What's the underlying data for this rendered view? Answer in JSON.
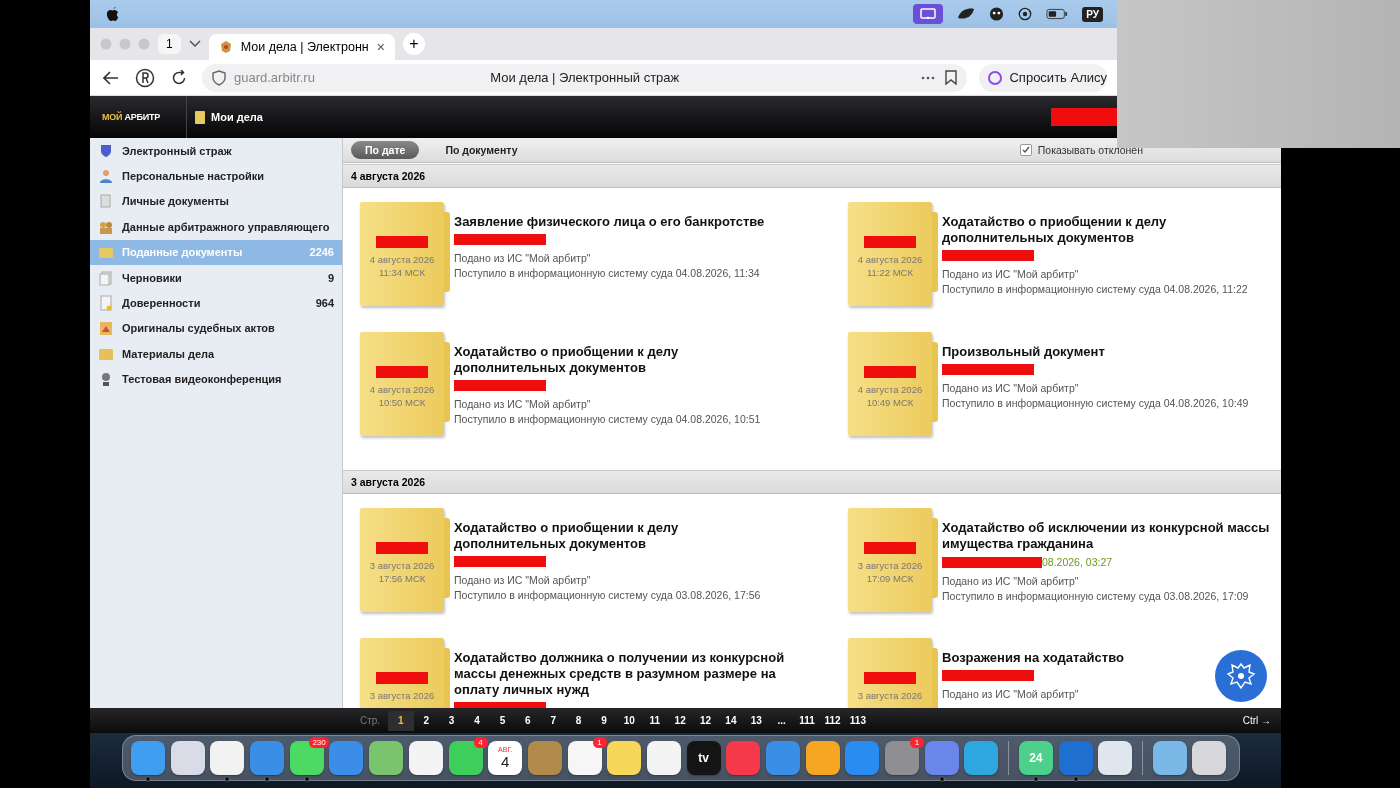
{
  "menubar": {
    "input_source": "РУ"
  },
  "browser": {
    "tab_count": "1",
    "tab": {
      "title": "Мои дела | Электронн",
      "close": "×"
    },
    "new_tab": "+",
    "address": "guard.arbitr.ru",
    "page_title": "Мои дела | Электронный страж",
    "assistant": "Спросить Алису"
  },
  "app_header": {
    "logo": [
      "МОЙ",
      "АРБИТР"
    ],
    "section": "Мои дела"
  },
  "sidebar": {
    "items": [
      {
        "label": "Электронный страж",
        "selected": false
      },
      {
        "label": "Персональные настройки",
        "selected": false
      },
      {
        "label": "Личные документы",
        "selected": false
      },
      {
        "label": "Данные арбитражного управляющего",
        "selected": false
      },
      {
        "label": "Поданные документы",
        "count": "2246",
        "selected": true
      },
      {
        "label": "Черновики",
        "count": "9",
        "selected": false
      },
      {
        "label": "Доверенности",
        "count": "964",
        "selected": false
      },
      {
        "label": "Оригиналы судебных актов",
        "selected": false
      },
      {
        "label": "Материалы дела",
        "selected": false
      },
      {
        "label": "Тестовая видеоконференция",
        "selected": false
      }
    ]
  },
  "toolbar": {
    "sort_tabs": [
      {
        "label": "По дате",
        "selected": true
      },
      {
        "label": "По документу",
        "selected": false
      }
    ],
    "show_rejected": {
      "label": "Показывать отклонен",
      "checked": true
    }
  },
  "sections": [
    {
      "date": "4 августа 2026",
      "documents": [
        {
          "title": "Заявление физического лица о его банкротстве",
          "source": "Подано из ИС \"Мой арбитр\"",
          "received": "Поступило в информационную систему суда 04.08.2026, 11:34",
          "folder_date": "4 августа 2026",
          "folder_time": "11:34 МСК"
        },
        {
          "title": "Ходатайство о приобщении к делу дополнительных документов",
          "source": "Подано из ИС \"Мой арбитр\"",
          "received": "Поступило в информационную систему суда 04.08.2026, 11:22",
          "folder_date": "4 августа 2026",
          "folder_time": "11:22 МСК"
        },
        {
          "title": "Ходатайство о приобщении к делу дополнительных документов",
          "source": "Подано из ИС \"Мой арбитр\"",
          "received": "Поступило в информационную систему суда 04.08.2026, 10:51",
          "folder_date": "4 августа 2026",
          "folder_time": "10:50 МСК"
        },
        {
          "title": "Произвольный документ",
          "source": "Подано из ИС \"Мой арбитр\"",
          "received": "Поступило в информационную систему суда 04.08.2026, 10:49",
          "folder_date": "4 августа 2026",
          "folder_time": "10:49 МСК"
        }
      ]
    },
    {
      "date": "3 августа 2026",
      "documents": [
        {
          "title": "Ходатайство о приобщении к делу дополнительных документов",
          "source": "Подано из ИС \"Мой арбитр\"",
          "received": "Поступило в информационную систему суда 03.08.2026, 17:56",
          "folder_date": "3 августа 2026",
          "folder_time": "17:56 МСК"
        },
        {
          "title": "Ходатайство об исключении из конкурсной массы имущества гражданина",
          "note": "08.2026, 03:27",
          "source": "Подано из ИС \"Мой арбитр\"",
          "received": "Поступило в информационную систему суда 03.08.2026, 17:09",
          "folder_date": "3 августа 2026",
          "folder_time": "17:09 МСК"
        },
        {
          "title": "Ходатайство должника о получении из конкурсной массы денежных средств в разумном размере на оплату личных нужд",
          "folder_date": "3 августа 2026"
        },
        {
          "title": "Возражения на ходатайство",
          "source": "Подано из ИС \"Мой арбитр\"",
          "folder_date": "3 августа 2026"
        }
      ]
    }
  ],
  "pager": {
    "label": "Стр.",
    "pages": [
      {
        "label": "1",
        "selected": true
      },
      {
        "label": "2",
        "selected": false
      },
      {
        "label": "3",
        "selected": false
      },
      {
        "label": "4",
        "selected": false
      },
      {
        "label": "5",
        "selected": false
      },
      {
        "label": "6",
        "selected": false
      },
      {
        "label": "7",
        "selected": false
      },
      {
        "label": "8",
        "selected": false
      },
      {
        "label": "9",
        "selected": false
      },
      {
        "label": "10",
        "selected": false
      },
      {
        "label": "11",
        "selected": false
      },
      {
        "label": "12",
        "selected": false
      },
      {
        "label": "12",
        "selected": false
      },
      {
        "label": "14",
        "selected": false
      },
      {
        "label": "13",
        "selected": false
      },
      {
        "label": "...",
        "selected": false
      },
      {
        "label": "111",
        "selected": false
      },
      {
        "label": "112",
        "selected": false
      },
      {
        "label": "113",
        "selected": false
      }
    ],
    "shortcut": "Ctrl →"
  },
  "dock": {
    "groups": [
      [
        {
          "color": "#3f9ef0",
          "running": true
        },
        {
          "color": "#d9dbe6",
          "running": false
        },
        {
          "color": "#f2f2f2",
          "running": true
        },
        {
          "color": "#3a8ee6",
          "running": true
        },
        {
          "color": "#4cd964",
          "badge": "230",
          "running": true
        },
        {
          "color": "#3b8de8",
          "running": false
        },
        {
          "color": "#79c46c",
          "running": false
        },
        {
          "color": "#f4f4f4",
          "running": false
        },
        {
          "color": "#3ecf5a",
          "badge": "4",
          "running": false
        },
        {
          "color": "#ffffff",
          "kind": "calendar",
          "month": "АВГ.",
          "day": "4",
          "running": false
        },
        {
          "color": "#b08a4a",
          "running": false
        },
        {
          "color": "#f6f6f6",
          "badge": "1",
          "running": false
        },
        {
          "color": "#f7d65a",
          "running": false
        },
        {
          "color": "#f4f4f4",
          "running": false
        },
        {
          "color": "#151515",
          "kind": "label",
          "label": "tv",
          "running": false
        },
        {
          "color": "#f6384b",
          "running": false
        },
        {
          "color": "#3a8ee6",
          "running": false
        },
        {
          "color": "#f5a623",
          "running": false
        },
        {
          "color": "#2a8cf0",
          "running": false
        },
        {
          "color": "#8e8e93",
          "badge": "1",
          "running": false
        },
        {
          "color": "#6b86ea",
          "running": true
        },
        {
          "color": "#2ea6e0",
          "running": false
        }
      ],
      [
        {
          "color": "#4cd08c",
          "kind": "label",
          "label": "24",
          "running": true
        },
        {
          "color": "#1e6fcf",
          "running": true
        },
        {
          "color": "#dfe6ee",
          "running": false
        }
      ],
      [
        {
          "color": "#7ab8e8",
          "running": false
        },
        {
          "color": "#d8d8dc",
          "running": false
        }
      ]
    ]
  }
}
